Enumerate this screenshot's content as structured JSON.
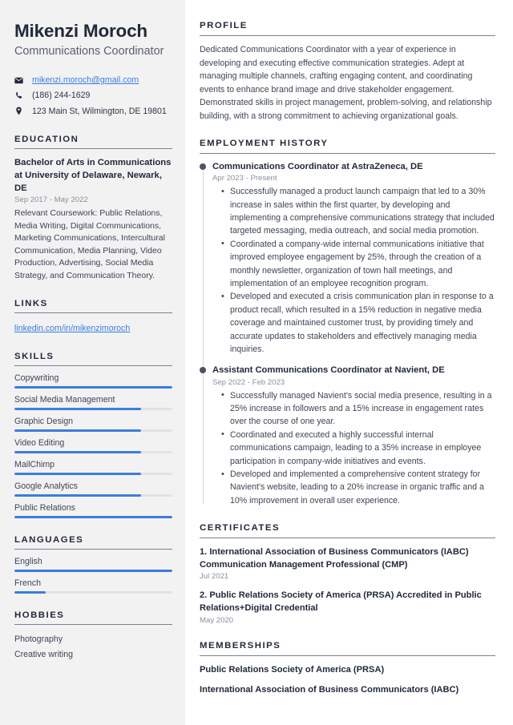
{
  "accent_color": "#3b7ddd",
  "sidebar_bg": "#f2f2f3",
  "heading_color": "#22293a",
  "header": {
    "name": "Mikenzi Moroch",
    "job_title": "Communications Coordinator",
    "contacts": [
      {
        "icon": "envelope-icon",
        "text": "mikenzi.moroch@gmail.com",
        "is_link": true
      },
      {
        "icon": "phone-icon",
        "text": "(186) 244-1629",
        "is_link": false
      },
      {
        "icon": "location-pin-icon",
        "text": "123 Main St, Wilmington, DE 19801",
        "is_link": false
      }
    ]
  },
  "education": {
    "heading": "EDUCATION",
    "items": [
      {
        "degree": "Bachelor of Arts in Communications at University of Delaware, Newark, DE",
        "date": "Sep 2017 - May 2022",
        "description": "Relevant Coursework: Public Relations, Media Writing, Digital Communications, Marketing Communications, Intercultural Communication, Media Planning, Video Production, Advertising, Social Media Strategy, and Communication Theory."
      }
    ]
  },
  "links": {
    "heading": "LINKS",
    "items": [
      {
        "label": "linkedin.com/in/mikenzimoroch"
      }
    ]
  },
  "skills": {
    "heading": "SKILLS",
    "items": [
      {
        "name": "Copywriting",
        "level": 100
      },
      {
        "name": "Social Media Management",
        "level": 80
      },
      {
        "name": "Graphic Design",
        "level": 80
      },
      {
        "name": "Video Editing",
        "level": 80
      },
      {
        "name": "MailChimp",
        "level": 80
      },
      {
        "name": "Google Analytics",
        "level": 80
      },
      {
        "name": "Public Relations",
        "level": 100
      }
    ]
  },
  "languages": {
    "heading": "LANGUAGES",
    "items": [
      {
        "name": "English",
        "level": 100
      },
      {
        "name": "French",
        "level": 20
      }
    ]
  },
  "hobbies": {
    "heading": "HOBBIES",
    "items": [
      {
        "name": "Photography"
      },
      {
        "name": "Creative writing"
      }
    ]
  },
  "profile": {
    "heading": "PROFILE",
    "text": "Dedicated Communications Coordinator with a year of experience in developing and executing effective communication strategies. Adept at managing multiple channels, crafting engaging content, and coordinating events to enhance brand image and drive stakeholder engagement. Demonstrated skills in project management, problem-solving, and relationship building, with a strong commitment to achieving organizational goals."
  },
  "employment": {
    "heading": "EMPLOYMENT HISTORY",
    "jobs": [
      {
        "title": "Communications Coordinator at AstraZeneca, DE",
        "date": "Apr 2023 - Present",
        "bullets": [
          "Successfully managed a product launch campaign that led to a 30% increase in sales within the first quarter, by developing and implementing a comprehensive communications strategy that included targeted messaging, media outreach, and social media promotion.",
          "Coordinated a company-wide internal communications initiative that improved employee engagement by 25%, through the creation of a monthly newsletter, organization of town hall meetings, and implementation of an employee recognition program.",
          "Developed and executed a crisis communication plan in response to a product recall, which resulted in a 15% reduction in negative media coverage and maintained customer trust, by providing timely and accurate updates to stakeholders and effectively managing media inquiries."
        ]
      },
      {
        "title": "Assistant Communications Coordinator at Navient, DE",
        "date": "Sep 2022 - Feb 2023",
        "bullets": [
          "Successfully managed Navient's social media presence, resulting in a 25% increase in followers and a 15% increase in engagement rates over the course of one year.",
          "Coordinated and executed a highly successful internal communications campaign, leading to a 35% increase in employee participation in company-wide initiatives and events.",
          "Developed and implemented a comprehensive content strategy for Navient's website, leading to a 20% increase in organic traffic and a 10% improvement in overall user experience."
        ]
      }
    ]
  },
  "certificates": {
    "heading": "CERTIFICATES",
    "items": [
      {
        "title": "1. International Association of Business Communicators (IABC) Communication Management Professional (CMP)",
        "date": "Jul 2021"
      },
      {
        "title": "2. Public Relations Society of America (PRSA) Accredited in Public Relations+Digital Credential",
        "date": "May 2020"
      }
    ]
  },
  "memberships": {
    "heading": "MEMBERSHIPS",
    "items": [
      {
        "name": "Public Relations Society of America (PRSA)"
      },
      {
        "name": "International Association of Business Communicators (IABC)"
      }
    ]
  }
}
